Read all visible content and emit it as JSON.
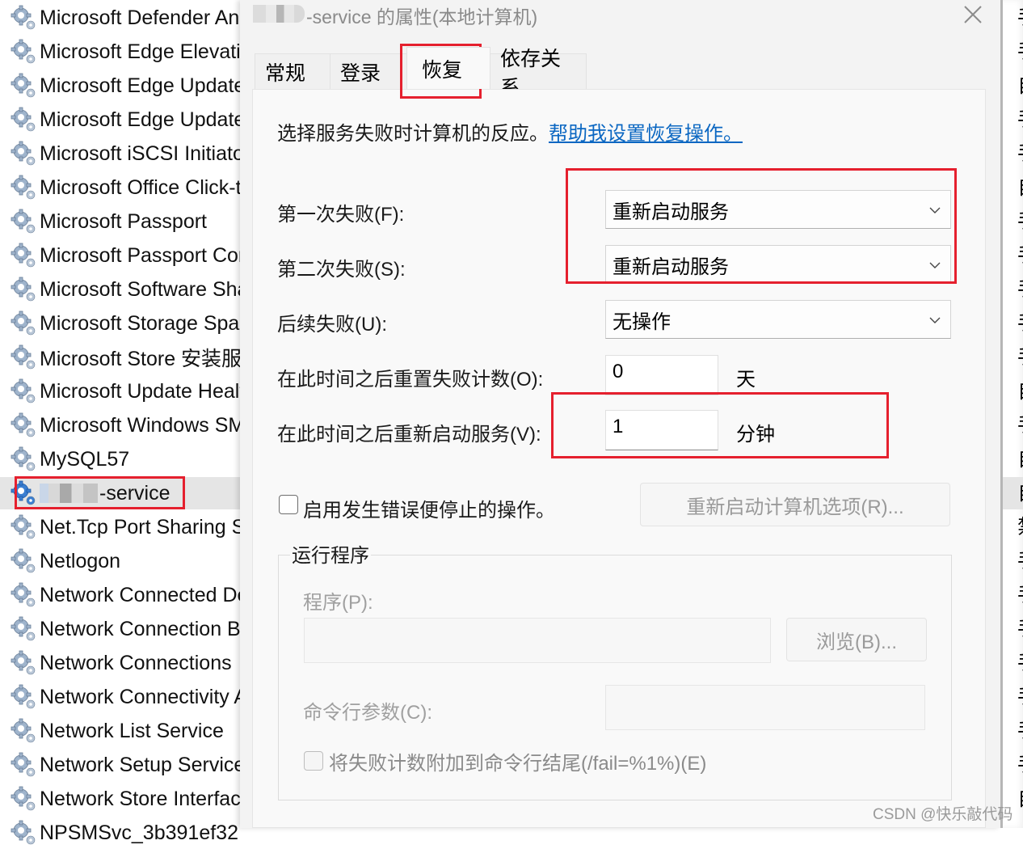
{
  "services_list": {
    "rows": [
      {
        "name": "Microsoft Defender An",
        "startup_abbrev": "手"
      },
      {
        "name": "Microsoft Edge Elevatic",
        "startup_abbrev": "手"
      },
      {
        "name": "Microsoft Edge Update",
        "startup_abbrev": "自"
      },
      {
        "name": "Microsoft Edge Update",
        "startup_abbrev": "手"
      },
      {
        "name": "Microsoft iSCSI Initiator",
        "startup_abbrev": "手"
      },
      {
        "name": "Microsoft Office Click-t",
        "startup_abbrev": "自"
      },
      {
        "name": "Microsoft Passport",
        "startup_abbrev": "手"
      },
      {
        "name": "Microsoft Passport Con",
        "startup_abbrev": "手"
      },
      {
        "name": "Microsoft Software Sha",
        "startup_abbrev": "手"
      },
      {
        "name": "Microsoft Storage Spac",
        "startup_abbrev": "手"
      },
      {
        "name": "Microsoft Store 安装服务",
        "startup_abbrev": "手"
      },
      {
        "name": "Microsoft Update Healt",
        "startup_abbrev": "自"
      },
      {
        "name": "Microsoft Windows SM",
        "startup_abbrev": "手"
      },
      {
        "name": "MySQL57",
        "startup_abbrev": "自"
      },
      {
        "name": "-service",
        "startup_abbrev": "自",
        "selected": true,
        "redacted_prefix": true
      },
      {
        "name": "Net.Tcp Port Sharing S",
        "startup_abbrev": "禁"
      },
      {
        "name": "Netlogon",
        "startup_abbrev": "手"
      },
      {
        "name": "Network Connected De",
        "startup_abbrev": "手"
      },
      {
        "name": "Network Connection B",
        "startup_abbrev": "手"
      },
      {
        "name": "Network Connections",
        "startup_abbrev": "手"
      },
      {
        "name": "Network Connectivity A",
        "startup_abbrev": "手"
      },
      {
        "name": "Network List Service",
        "startup_abbrev": "手"
      },
      {
        "name": "Network Setup Service",
        "startup_abbrev": "手"
      },
      {
        "name": "Network Store Interfac",
        "startup_abbrev": "自"
      },
      {
        "name": "NPSMSvc_3b391ef32",
        "startup_abbrev": ""
      }
    ]
  },
  "dialog": {
    "title": "-service 的属性(本地计算机)",
    "close_icon": "close-icon",
    "tabs": [
      {
        "label": "常规",
        "active": false
      },
      {
        "label": "登录",
        "active": false
      },
      {
        "label": "恢复",
        "active": true
      },
      {
        "label": "依存关系",
        "active": false
      }
    ],
    "recovery": {
      "intro": "选择服务失败时计算机的反应。",
      "help_link": "帮助我设置恢复操作。",
      "first_failure_label": "第一次失败(F):",
      "first_failure_value": "重新启动服务",
      "second_failure_label": "第二次失败(S):",
      "second_failure_value": "重新启动服务",
      "subsequent_label": "后续失败(U):",
      "subsequent_value": "无操作",
      "reset_count_label": "在此时间之后重置失败计数(O):",
      "reset_count_value": "0",
      "reset_count_unit": "天",
      "restart_after_label": "在此时间之后重新启动服务(V):",
      "restart_after_value": "1",
      "restart_after_unit": "分钟",
      "enable_actions_label": "启用发生错误便停止的操作。",
      "enable_actions_checked": false,
      "restart_computer_button": "重新启动计算机选项(R)...",
      "run_program": {
        "group_title": "运行程序",
        "program_label": "程序(P):",
        "program_value": "",
        "browse_button": "浏览(B)...",
        "cmdline_label": "命令行参数(C):",
        "cmdline_value": "",
        "append_fail_label": "将失败计数附加到命令行结尾(/fail=%1%)(E)",
        "append_fail_checked": false
      }
    }
  },
  "watermark": "CSDN @快乐敲代码",
  "colors": {
    "highlight_box": "#e5202e",
    "link": "#0b67c2",
    "selected_row": "#e5e5e5"
  }
}
